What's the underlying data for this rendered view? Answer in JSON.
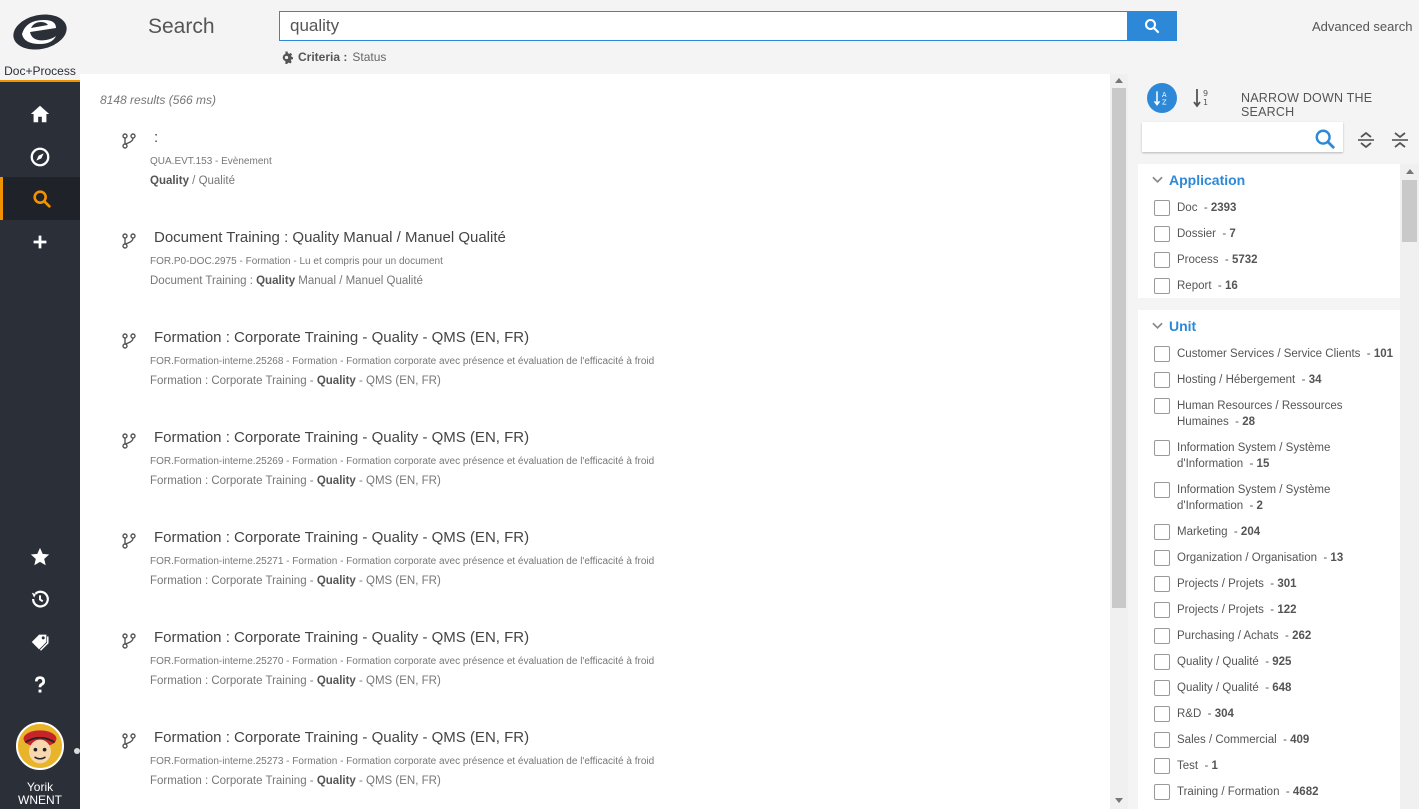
{
  "app": {
    "logo_text": "Doc+Process",
    "user_name_line1": "Yorik",
    "user_name_line2": "WNENT"
  },
  "colors": {
    "sidebar_bg": "#2b2f38",
    "accent_orange": "#f39200",
    "primary_blue": "#2d89d8"
  },
  "sidebar": {
    "items": [
      {
        "name": "home",
        "icon": "home-icon"
      },
      {
        "name": "explore",
        "icon": "compass-icon"
      },
      {
        "name": "search",
        "icon": "search-icon",
        "active": true
      },
      {
        "name": "create",
        "icon": "plus-icon"
      },
      {
        "name": "favorites",
        "icon": "star-icon"
      },
      {
        "name": "history",
        "icon": "history-icon"
      },
      {
        "name": "tags",
        "icon": "tags-icon"
      },
      {
        "name": "help",
        "icon": "question-icon"
      }
    ]
  },
  "header": {
    "title": "Search",
    "query": "quality",
    "criteria_label": "Criteria :",
    "criteria_value": "Status",
    "advanced_search": "Advanced search"
  },
  "results": {
    "meta": "8148 results (566 ms)",
    "items": [
      {
        "title": ":",
        "code": "QUA.EVT.153 - Evènement",
        "snip_pre": "",
        "snip_bold": "Quality",
        "snip_post": " / Qualité"
      },
      {
        "title": "Document Training : Quality Manual / Manuel Qualité",
        "code": "FOR.P0-DOC.2975 - Formation - Lu et compris pour un document",
        "snip_pre": "Document Training : ",
        "snip_bold": "Quality",
        "snip_post": " Manual / Manuel Qualité"
      },
      {
        "title": "Formation : Corporate Training - Quality - QMS (EN, FR)",
        "code": "FOR.Formation-interne.25268 - Formation - Formation corporate avec présence et évaluation de l'efficacité à froid",
        "snip_pre": "Formation : Corporate Training - ",
        "snip_bold": "Quality",
        "snip_post": " - QMS (EN, FR)"
      },
      {
        "title": "Formation : Corporate Training - Quality - QMS (EN, FR)",
        "code": "FOR.Formation-interne.25269 - Formation - Formation corporate avec présence et évaluation de l'efficacité à froid",
        "snip_pre": "Formation : Corporate Training - ",
        "snip_bold": "Quality",
        "snip_post": " - QMS (EN, FR)"
      },
      {
        "title": "Formation : Corporate Training - Quality - QMS (EN, FR)",
        "code": "FOR.Formation-interne.25271 - Formation - Formation corporate avec présence et évaluation de l'efficacité à froid",
        "snip_pre": "Formation : Corporate Training - ",
        "snip_bold": "Quality",
        "snip_post": " - QMS (EN, FR)"
      },
      {
        "title": "Formation : Corporate Training - Quality - QMS (EN, FR)",
        "code": "FOR.Formation-interne.25270 - Formation - Formation corporate avec présence et évaluation de l'efficacité à froid",
        "snip_pre": "Formation : Corporate Training - ",
        "snip_bold": "Quality",
        "snip_post": " - QMS (EN, FR)"
      },
      {
        "title": "Formation : Corporate Training - Quality - QMS (EN, FR)",
        "code": "FOR.Formation-interne.25273 - Formation - Formation corporate avec présence et évaluation de l'efficacité à froid",
        "snip_pre": "Formation : Corporate Training - ",
        "snip_bold": "Quality",
        "snip_post": " - QMS (EN, FR)"
      }
    ]
  },
  "panel": {
    "narrow_title": "NARROW DOWN THE SEARCH",
    "filter_placeholder": "",
    "application": {
      "title": "Application",
      "items": [
        {
          "label": "Doc",
          "count": "2393"
        },
        {
          "label": "Dossier",
          "count": "7"
        },
        {
          "label": "Process",
          "count": "5732"
        },
        {
          "label": "Report",
          "count": "16"
        }
      ]
    },
    "unit": {
      "title": "Unit",
      "items": [
        {
          "label": "Customer Services / Service Clients",
          "count": "101"
        },
        {
          "label": "Hosting / Hébergement",
          "count": "34"
        },
        {
          "label": "Human Resources / Ressources Humaines",
          "count": "28"
        },
        {
          "label": "Information System / Système d'Information",
          "count": "15"
        },
        {
          "label": "Information System / Système d'Information",
          "count": "2"
        },
        {
          "label": "Marketing",
          "count": "204"
        },
        {
          "label": "Organization / Organisation",
          "count": "13"
        },
        {
          "label": "Projects / Projets",
          "count": "301"
        },
        {
          "label": "Projects / Projets",
          "count": "122"
        },
        {
          "label": "Purchasing / Achats",
          "count": "262"
        },
        {
          "label": "Quality / Qualité",
          "count": "925"
        },
        {
          "label": "Quality / Qualité",
          "count": "648"
        },
        {
          "label": "R&D",
          "count": "304"
        },
        {
          "label": "Sales / Commercial",
          "count": "409"
        },
        {
          "label": "Test",
          "count": "1"
        },
        {
          "label": "Training / Formation",
          "count": "4682"
        }
      ]
    }
  }
}
